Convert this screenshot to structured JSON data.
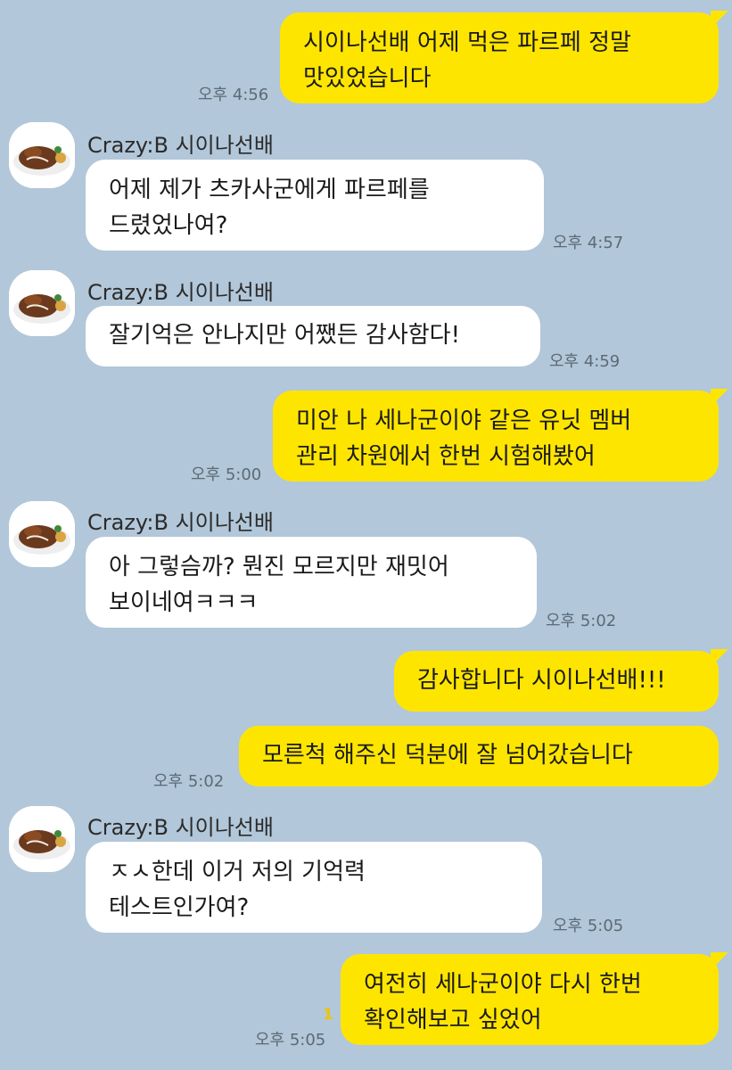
{
  "sender_name": "Crazy:B 시이나선배",
  "messages": [
    {
      "id": "m1",
      "from": "me",
      "lines": [
        "시이나선배 어제 먹은 파르페 정말",
        "맛있었습니다"
      ],
      "time": "오후 4:56"
    },
    {
      "id": "m2",
      "from": "other",
      "lines": [
        "어제 제가 츠카사군에게 파르페를",
        "드렸었나여?"
      ],
      "time": "오후 4:57"
    },
    {
      "id": "m3",
      "from": "other",
      "lines": [
        "잘기억은 안나지만 어쨌든 감사함다!"
      ],
      "time": "오후 4:59"
    },
    {
      "id": "m4",
      "from": "me",
      "lines": [
        "미안 나 세나군이야 같은 유닛 멤버",
        "관리 차원에서 한번 시험해봤어"
      ],
      "time": "오후 5:00"
    },
    {
      "id": "m5",
      "from": "other",
      "lines": [
        "아 그렇슴까? 뭔진 모르지만 재밋어",
        "보이네여ㅋㅋㅋ"
      ],
      "time": "오후 5:02"
    },
    {
      "id": "m6",
      "from": "me",
      "lines": [
        "감사합니다 시이나선배!!!"
      ],
      "time": ""
    },
    {
      "id": "m7",
      "from": "me",
      "lines": [
        "모른척 해주신 덕분에 잘 넘어갔습니다"
      ],
      "time": "오후 5:02"
    },
    {
      "id": "m8",
      "from": "other",
      "lines": [
        "ㅈㅅ한데 이거 저의 기억력",
        "테스트인가여?"
      ],
      "time": "오후 5:05"
    },
    {
      "id": "m9",
      "from": "me",
      "lines": [
        "여전히 세나군이야 다시 한번",
        "확인해보고 싶었어"
      ],
      "time": "오후 5:05",
      "unread": "1"
    }
  ],
  "colors": {
    "background": "#b2c7d9",
    "my_bubble": "#fee500",
    "other_bubble": "#ffffff",
    "unread": "#f0c400"
  },
  "icons": {
    "avatar": "food-plate-avatar-icon"
  }
}
